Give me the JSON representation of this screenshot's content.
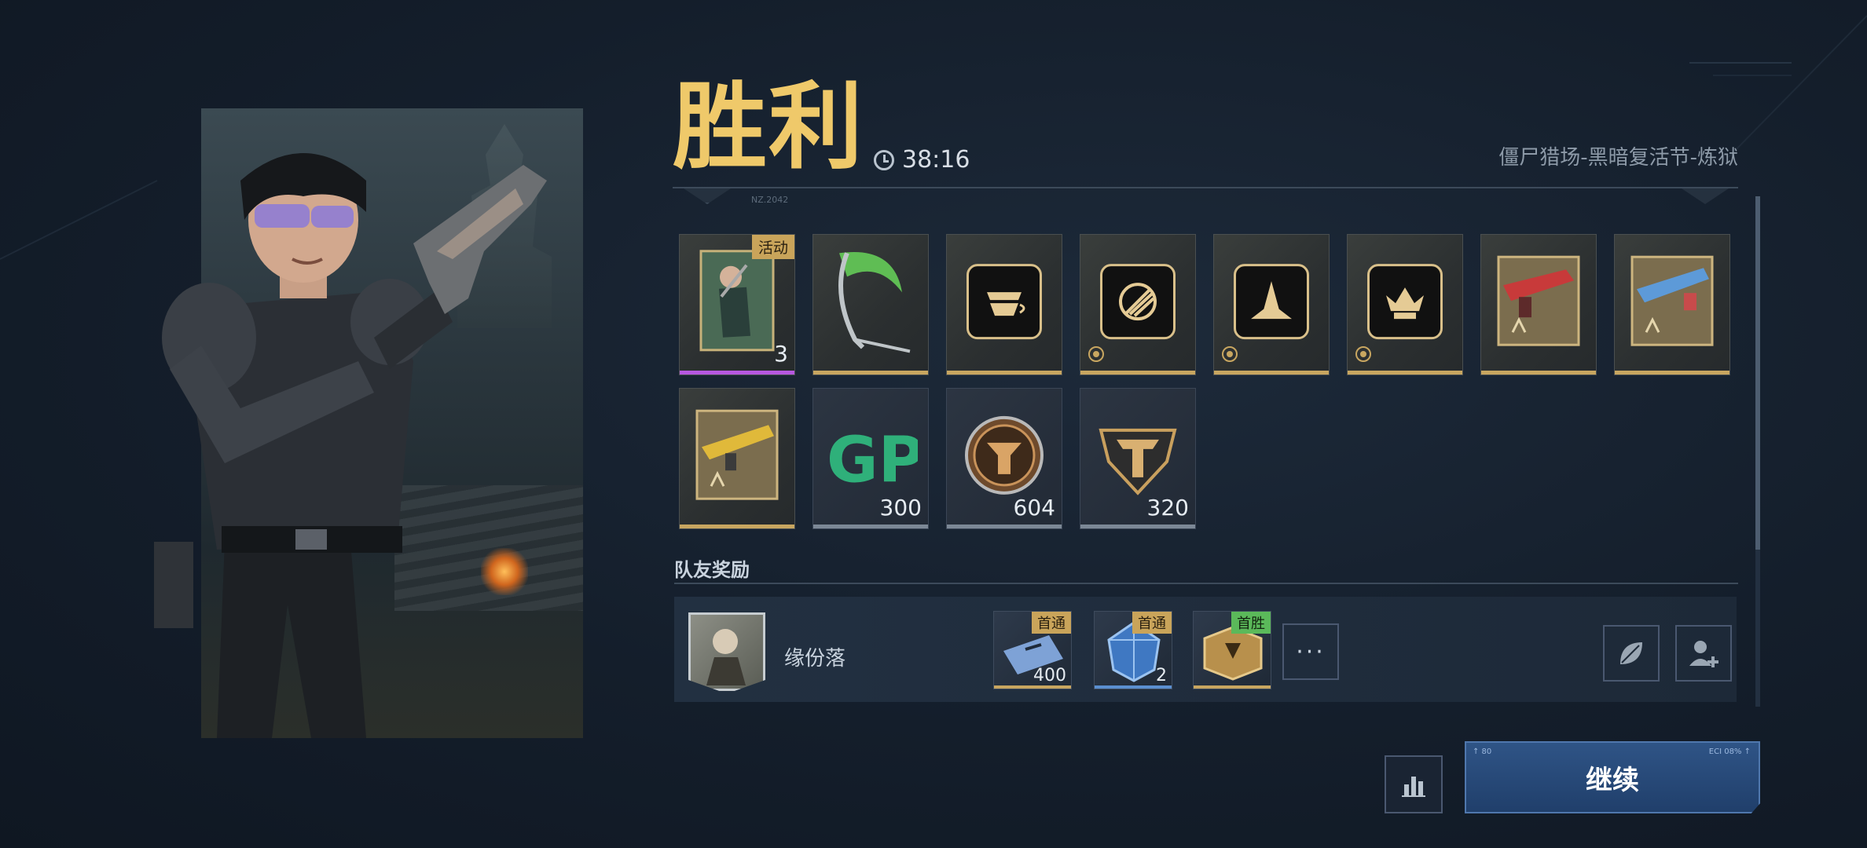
{
  "header": {
    "result_title": "胜利",
    "match_time": "38:16",
    "mode_label": "僵尸猎场-黑暗复活节-炼狱",
    "deco_label": "NZ.2042"
  },
  "rewards": [
    {
      "type": "card",
      "badge": "活动",
      "count": "3",
      "rarity": "purple"
    },
    {
      "type": "scythe",
      "badge": "",
      "count": "",
      "rarity": "gold"
    },
    {
      "type": "emblem-coffee",
      "badge": "",
      "count": "",
      "rarity": "gold"
    },
    {
      "type": "emblem-arrows",
      "badge": "",
      "count": "",
      "rarity": "gold"
    },
    {
      "type": "emblem-spikes",
      "badge": "",
      "count": "",
      "rarity": "gold"
    },
    {
      "type": "emblem-crown",
      "badge": "",
      "count": "",
      "rarity": "gold"
    },
    {
      "type": "weapon-red-blueprint",
      "badge": "",
      "count": "",
      "rarity": "gold"
    },
    {
      "type": "weapon-blue-blueprint",
      "badge": "",
      "count": "",
      "rarity": "gold"
    },
    {
      "type": "weapon-gold-blueprint",
      "badge": "",
      "count": "",
      "rarity": "gold"
    },
    {
      "type": "gp-currency",
      "badge": "",
      "count": "300",
      "rarity": "grey"
    },
    {
      "type": "bronze-coin",
      "badge": "",
      "count": "604",
      "rarity": "grey"
    },
    {
      "type": "rank-points",
      "badge": "",
      "count": "320",
      "rarity": "grey"
    }
  ],
  "team": {
    "section_title": "队友奖励",
    "teammate_name": "缘份落",
    "rewards": [
      {
        "type": "ticket",
        "badge": "首通",
        "count": "400",
        "badge_color": "gold"
      },
      {
        "type": "blue-crystal",
        "badge": "首通",
        "count": "2",
        "badge_color": "gold"
      },
      {
        "type": "gold-crate",
        "badge": "首胜",
        "count": "",
        "badge_color": "green"
      }
    ],
    "more_label": "···"
  },
  "buttons": {
    "continue_label": "继续",
    "continue_tiny_left": "↑ 80",
    "continue_tiny_right": "ECI 08% ↑"
  },
  "colors": {
    "title_gold": "#efc96a",
    "accent_blue": "#2f5486",
    "rarity_gold": "#c8a660",
    "rarity_purple": "#b658e0"
  }
}
